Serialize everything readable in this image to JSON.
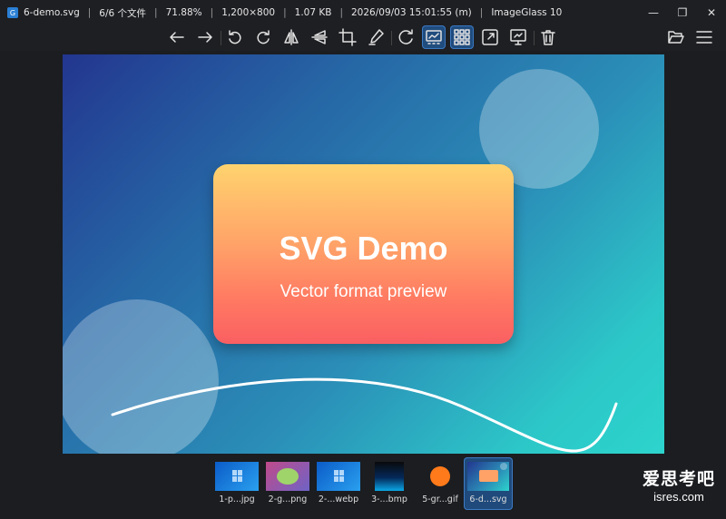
{
  "titlebar": {
    "filename": "6-demo.svg",
    "index": "6/6 个文件",
    "zoom": "71.88%",
    "dimensions": "1,200×800",
    "filesize": "1.07 KB",
    "datetime": "2026/09/03 15:01:55 (m)",
    "app": "ImageGlass 10",
    "app_icon_glyph": "G",
    "minimize": "—",
    "maximize": "❐",
    "close": "✕"
  },
  "toolbar": {
    "buttons": [
      {
        "name": "back-icon",
        "active": false
      },
      {
        "name": "forward-icon",
        "active": false
      },
      {
        "name": "rotate-left-icon",
        "active": false
      },
      {
        "name": "rotate-right-icon",
        "active": false
      },
      {
        "name": "flip-horizontal-icon",
        "active": false
      },
      {
        "name": "flip-vertical-icon",
        "active": false
      },
      {
        "name": "crop-icon",
        "active": false
      },
      {
        "name": "color-picker-icon",
        "active": false
      },
      {
        "name": "refresh-icon",
        "active": false
      },
      {
        "name": "gallery-icon",
        "active": true
      },
      {
        "name": "thumbnail-grid-icon",
        "active": true
      },
      {
        "name": "fullscreen-icon",
        "active": false
      },
      {
        "name": "slideshow-icon",
        "active": false
      },
      {
        "name": "delete-icon",
        "active": false
      },
      {
        "name": "open-folder-icon",
        "active": false
      },
      {
        "name": "menu-icon",
        "active": false
      }
    ]
  },
  "image": {
    "title": "SVG Demo",
    "subtitle": "Vector format preview"
  },
  "thumbnails": [
    {
      "label": "1-p...jpg",
      "active": false
    },
    {
      "label": "2-g...png",
      "active": false
    },
    {
      "label": "2-...webp",
      "active": false
    },
    {
      "label": "3-...bmp",
      "active": false
    },
    {
      "label": "5-gr...gif",
      "active": false
    },
    {
      "label": "6-d...svg",
      "active": true
    }
  ],
  "watermark": {
    "cn": "爱思考吧",
    "en": "isres.com"
  }
}
